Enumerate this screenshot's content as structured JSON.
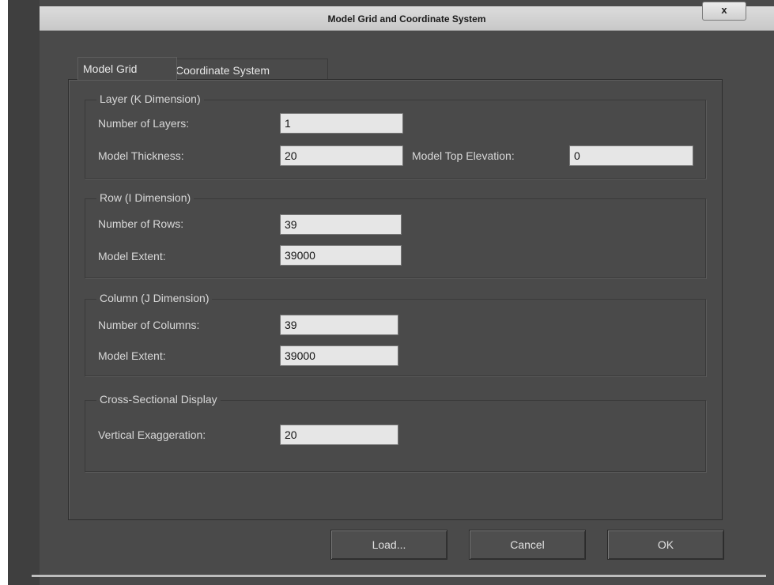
{
  "window": {
    "title": "Model Grid and Coordinate System",
    "close_label": "x"
  },
  "tabs": [
    {
      "label": "Model Grid",
      "active": true
    },
    {
      "label": "Coordinate System",
      "active": false
    }
  ],
  "layer_group": {
    "title": "Layer (K Dimension)",
    "num_layers_label": "Number of Layers:",
    "num_layers_value": "1",
    "thickness_label": "Model Thickness:",
    "thickness_value": "20",
    "top_elev_label": "Model Top Elevation:",
    "top_elev_value": "0"
  },
  "row_group": {
    "title": "Row (I Dimension)",
    "num_rows_label": "Number of Rows:",
    "num_rows_value": "39",
    "extent_label": "Model Extent:",
    "extent_value": "39000"
  },
  "column_group": {
    "title": "Column (J Dimension)",
    "num_cols_label": "Number of Columns:",
    "num_cols_value": "39",
    "extent_label": "Model Extent:",
    "extent_value": "39000"
  },
  "cross_section_group": {
    "title": "Cross-Sectional Display",
    "vert_exag_label": "Vertical Exaggeration:",
    "vert_exag_value": "20"
  },
  "buttons": {
    "load": "Load...",
    "cancel": "Cancel",
    "ok": "OK"
  },
  "colors": {
    "dialog_bg": "#4a4a4a",
    "titlebar_bg": "#d0d0d0",
    "field_bg": "#e6e6e6"
  }
}
